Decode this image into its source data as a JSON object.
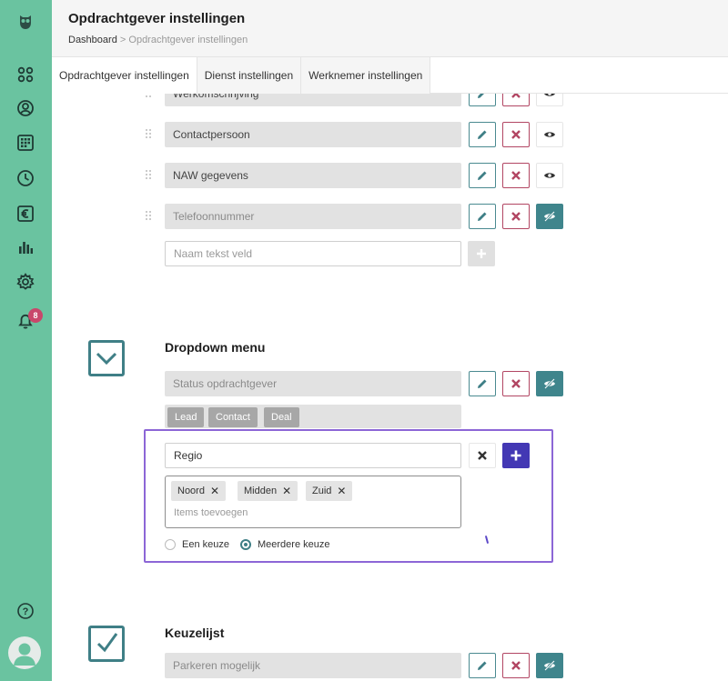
{
  "header": {
    "title": "Opdrachtgever instellingen",
    "breadcrumb": {
      "home": "Dashboard",
      "separator": ">",
      "current": "Opdrachtgever instellingen"
    }
  },
  "tabs": [
    {
      "label": "Opdrachtgever instellingen",
      "active": true
    },
    {
      "label": "Dienst instellingen",
      "active": false
    },
    {
      "label": "Werknemer instellingen",
      "active": false
    }
  ],
  "sidebar": {
    "notification_count": "8",
    "items": [
      "grid-icon",
      "user-icon",
      "calendar-icon",
      "clock-icon",
      "euro-icon",
      "chart-icon",
      "gear-icon",
      "bell-icon"
    ],
    "help": "?"
  },
  "text_fields": {
    "rows": [
      {
        "label": "Werkomschrijving"
      },
      {
        "label": "Contactpersoon"
      },
      {
        "label": "NAW gegevens"
      },
      {
        "label": "Telefoonnummer",
        "hidden": true
      }
    ],
    "new_field_placeholder": "Naam tekst veld"
  },
  "dropdown": {
    "title": "Dropdown menu",
    "existing": {
      "label": "Status opdrachtgever",
      "options": [
        "Lead",
        "Contact",
        "Deal"
      ]
    },
    "editor": {
      "name_value": "Regio",
      "tags": [
        "Noord",
        "Midden",
        "Zuid"
      ],
      "items_placeholder": "Items toevoegen",
      "choice_single": "Een keuze",
      "choice_multiple": "Meerdere keuze",
      "selected": "multiple"
    }
  },
  "keuzelijst": {
    "title": "Keuzelijst",
    "rows": [
      {
        "label": "Parkeren mogelijk"
      }
    ]
  },
  "colors": {
    "sidebar": "#6ac3a0",
    "teal": "#3f858c",
    "danger": "#b24663",
    "purple": "#4338b4",
    "highlight": "#8c66d6"
  }
}
